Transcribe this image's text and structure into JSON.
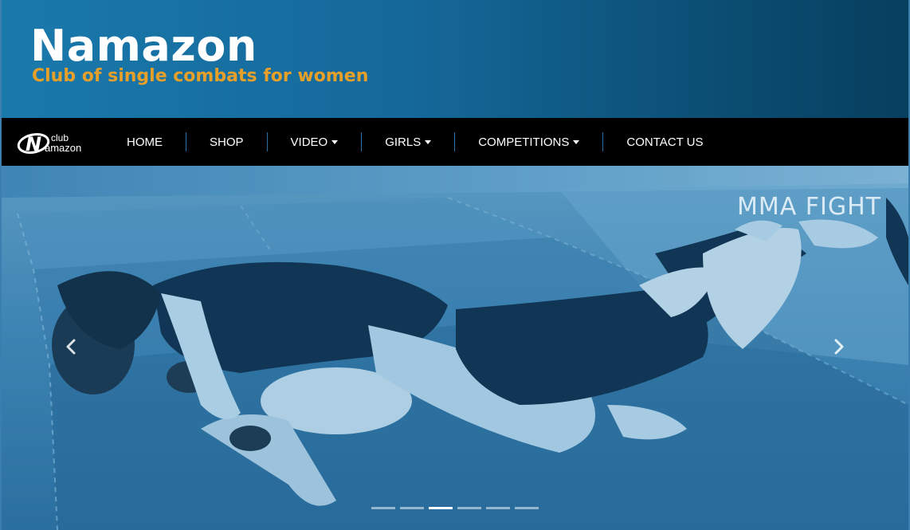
{
  "header": {
    "title": "Namazon",
    "tagline": "Club of single combats for women",
    "colors": {
      "background_start": "#1a79ab",
      "background_end": "#073f5f",
      "title": "#ffffff",
      "tagline": "#e6a02a"
    }
  },
  "navbar": {
    "logo": {
      "icon": "namazon-logo-icon",
      "text_top": "club",
      "text_bottom": "amazon",
      "letter": "N"
    },
    "items": [
      {
        "label": "HOME",
        "dropdown": false
      },
      {
        "label": "SHOP",
        "dropdown": false
      },
      {
        "label": "VIDEO",
        "dropdown": true
      },
      {
        "label": "GIRLS",
        "dropdown": true
      },
      {
        "label": "COMPETITIONS",
        "dropdown": true
      },
      {
        "label": "CONTACT US",
        "dropdown": false
      }
    ],
    "colors": {
      "background": "#000000",
      "separator": "#2d6fa3",
      "text": "#ffffff"
    }
  },
  "carousel": {
    "caption": "MMA  FIGHT",
    "prev_icon": "chevron-left-icon",
    "next_icon": "chevron-right-icon",
    "slide_count": 6,
    "active_index": 2,
    "image_description_icon": "mma-grappling-photo"
  }
}
